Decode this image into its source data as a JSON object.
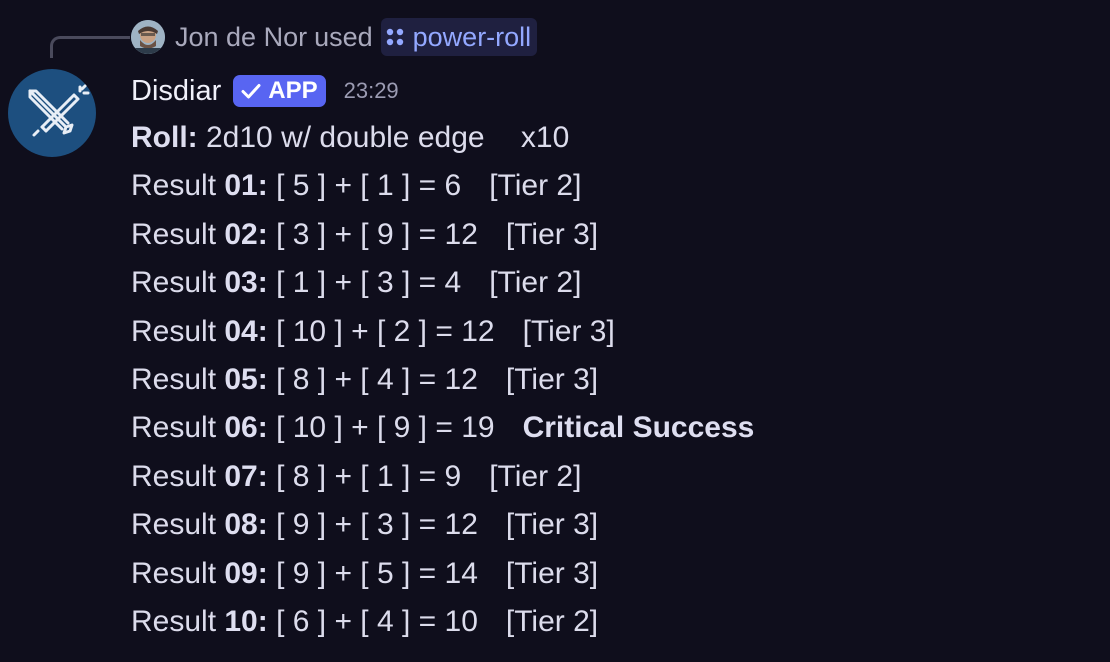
{
  "reply": {
    "user": "Jon de Nor",
    "used_text": "used",
    "command": "power-roll",
    "command_icon": "apps-grid-icon"
  },
  "message": {
    "username": "Disdiar",
    "badge": "APP",
    "timestamp": "23:29",
    "avatar_icon": "crossed-swords-icon",
    "avatar_color": "#1d4f7f"
  },
  "roll": {
    "label": "Roll:",
    "expression": "2d10 w/ double edge",
    "multiplier": "x10"
  },
  "results": [
    {
      "prefix": "Result ",
      "num": "01:",
      "calc": "[ 5 ] + [ 1 ] = 6",
      "tier": "[Tier 2]",
      "tier_bold": false
    },
    {
      "prefix": "Result ",
      "num": "02:",
      "calc": "[ 3 ] + [ 9 ] = 12",
      "tier": "[Tier 3]",
      "tier_bold": false
    },
    {
      "prefix": "Result ",
      "num": "03:",
      "calc": "[ 1 ] + [ 3 ] = 4",
      "tier": "[Tier 2]",
      "tier_bold": false
    },
    {
      "prefix": "Result ",
      "num": "04:",
      "calc": "[ 10 ] + [ 2 ] = 12",
      "tier": "[Tier 3]",
      "tier_bold": false
    },
    {
      "prefix": "Result ",
      "num": "05:",
      "calc": "[ 8 ] + [ 4 ] = 12",
      "tier": "[Tier 3]",
      "tier_bold": false
    },
    {
      "prefix": "Result ",
      "num": "06:",
      "calc": "[ 10 ] + [ 9 ] = 19",
      "tier": "Critical Success",
      "tier_bold": true
    },
    {
      "prefix": "Result ",
      "num": "07:",
      "calc": "[ 8 ] + [ 1 ] = 9",
      "tier": "[Tier 2]",
      "tier_bold": false
    },
    {
      "prefix": "Result ",
      "num": "08:",
      "calc": "[ 9 ] + [ 3 ] = 12",
      "tier": "[Tier 3]",
      "tier_bold": false
    },
    {
      "prefix": "Result ",
      "num": "09:",
      "calc": "[ 9 ] + [ 5 ] = 14",
      "tier": "[Tier 3]",
      "tier_bold": false
    },
    {
      "prefix": "Result ",
      "num": "10:",
      "calc": "[ 6 ] + [ 4 ] = 10",
      "tier": "[Tier 2]",
      "tier_bold": false
    }
  ],
  "colors": {
    "background": "#0f0e1c",
    "text": "#dcdcec",
    "command_link": "#93a8ff",
    "badge": "#5865f2"
  }
}
